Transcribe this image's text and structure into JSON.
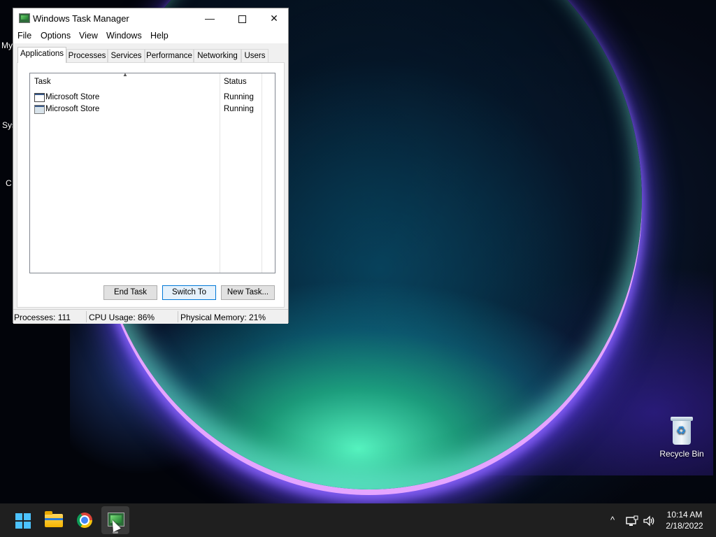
{
  "desktop": {
    "edge_fragments": [
      "My",
      "Sys",
      "C"
    ],
    "recycle_bin_label": "Recycle Bin"
  },
  "window": {
    "title": "Windows Task Manager",
    "controls": {
      "minimize": "—",
      "close": "✕"
    }
  },
  "menu": [
    "File",
    "Options",
    "View",
    "Windows",
    "Help"
  ],
  "tabs": [
    "Applications",
    "Processes",
    "Services",
    "Performance",
    "Networking",
    "Users"
  ],
  "active_tab": "Applications",
  "task_list": {
    "columns": [
      "Task",
      "Status"
    ],
    "rows": [
      {
        "task": "Microsoft Store",
        "status": "Running"
      },
      {
        "task": "Microsoft Store",
        "status": "Running"
      }
    ]
  },
  "buttons": {
    "end_task": "End Task",
    "switch_to": "Switch To",
    "new_task": "New Task..."
  },
  "status_bar": {
    "processes": "Processes: 111",
    "cpu": "CPU Usage: 86%",
    "memory": "Physical Memory: 21%"
  },
  "taskbar": {
    "apps": [
      "windows-start",
      "file-explorer",
      "chrome",
      "task-manager"
    ],
    "tray_chevron": "^",
    "time": "10:14 AM",
    "date": "2/18/2022"
  },
  "colors": {
    "accent": "#0078d7",
    "taskbar": "#1f1f1f"
  }
}
